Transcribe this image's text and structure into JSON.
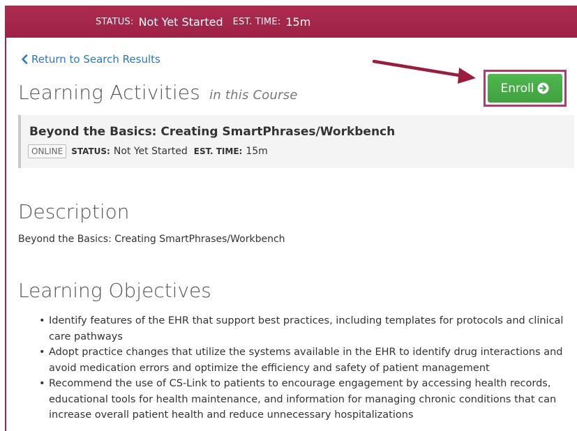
{
  "topbar": {
    "status_label": "STATUS:",
    "status_value": "Not Yet Started",
    "time_label": "EST. TIME:",
    "time_value": "15m"
  },
  "nav": {
    "back_label": "Return to Search Results"
  },
  "activities": {
    "heading": "Learning Activities",
    "heading_suffix": "in this Course",
    "enroll_label": "Enroll",
    "items": [
      {
        "title": "Beyond the Basics: Creating SmartPhrases/Workbench",
        "badge": "ONLINE",
        "status_label": "STATUS:",
        "status_value": "Not Yet Started",
        "time_label": "EST. TIME:",
        "time_value": "15m"
      }
    ]
  },
  "description": {
    "heading": "Description",
    "text": "Beyond the Basics: Creating SmartPhrases/Workbench"
  },
  "objectives": {
    "heading": "Learning Objectives",
    "items": [
      "Identify features of the EHR that support best practices, including templates for protocols and clinical care pathways",
      "Adopt practice changes that utilize the systems available in the EHR to identify drug interactions and avoid medication errors and optimize the efficiency and safety of patient management",
      "Recommend the use of CS-Link to patients to encourage engagement by accessing health records, educational tools for health maintenance, and information for managing chronic conditions that can increase overall patient health and reduce unnecessary hospitalizations"
    ]
  },
  "colors": {
    "brand": "#a6274a",
    "link": "#2a78c0",
    "enroll": "#46ad46",
    "annotation_arrow": "#9b1c3f"
  },
  "icons": [
    "chevron-left-icon",
    "circle-arrow-right-icon",
    "annotation-arrow-icon"
  ]
}
